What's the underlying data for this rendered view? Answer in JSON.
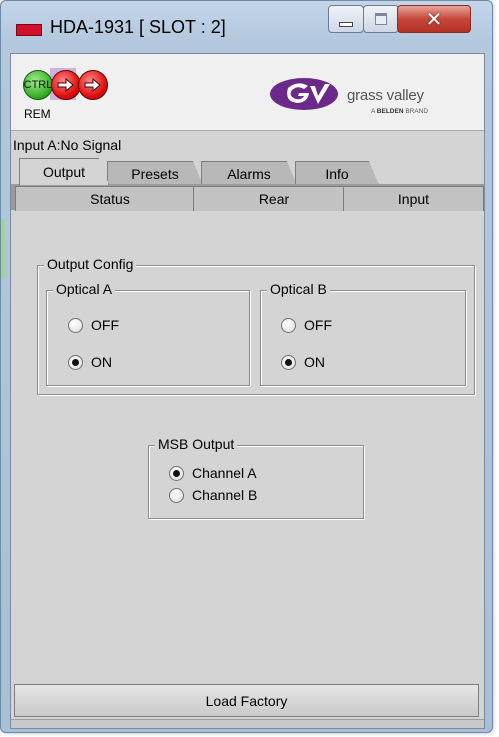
{
  "window": {
    "title": "HDA-1931 [ SLOT : 2]",
    "buttons": {
      "minimize": "minimize-icon",
      "maximize": "maximize-icon",
      "close": "close-icon"
    }
  },
  "header": {
    "ctrl_icon_text": "CTRL",
    "rem_label": "REM",
    "logo": {
      "name": "grass valley",
      "sub_prefix": "A",
      "sub_brand": "BELDEN",
      "sub_suffix": "BRAND",
      "color": "#6b2a8a"
    }
  },
  "status_text": "Input A:No Signal",
  "tabs_top": [
    {
      "label": "Output",
      "selected": true
    },
    {
      "label": "Presets",
      "selected": false
    },
    {
      "label": "Alarms",
      "selected": false
    },
    {
      "label": "Info",
      "selected": false
    }
  ],
  "tabs_bottom": [
    {
      "label": "Status"
    },
    {
      "label": "Rear"
    },
    {
      "label": "Input"
    }
  ],
  "output_config": {
    "title": "Output Config",
    "optical_a": {
      "title": "Optical A",
      "options": [
        {
          "label": "OFF",
          "checked": false
        },
        {
          "label": "ON",
          "checked": true
        }
      ]
    },
    "optical_b": {
      "title": "Optical B",
      "options": [
        {
          "label": "OFF",
          "checked": false
        },
        {
          "label": "ON",
          "checked": true
        }
      ]
    }
  },
  "msb_output": {
    "title": "MSB Output",
    "options": [
      {
        "label": "Channel A",
        "checked": true
      },
      {
        "label": "Channel B",
        "checked": false
      }
    ]
  },
  "load_factory_label": "Load Factory"
}
